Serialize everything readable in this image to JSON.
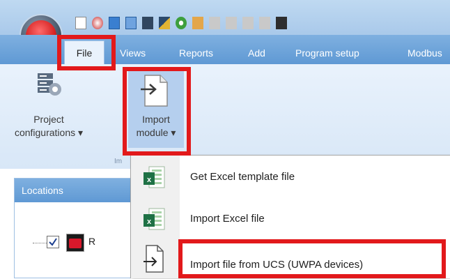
{
  "ribbon_tabs": {
    "file": "File",
    "views": "Views",
    "reports": "Reports",
    "add": "Add",
    "program_setup": "Program setup",
    "modbus": "Modbus"
  },
  "ribbon": {
    "project_configurations": "Project configurations",
    "project_configurations_line1": "Project",
    "project_configurations_line2": "configurations ▾",
    "import_module_line1": "Import",
    "import_module_line2": "module ▾",
    "group_label_partial": "Im"
  },
  "locations_panel": {
    "title": "Locations",
    "tree_item_partial": "R"
  },
  "import_menu": {
    "items": [
      {
        "label": "Get Excel template file",
        "icon": "excel-icon"
      },
      {
        "label": "Import Excel file",
        "icon": "excel-icon"
      },
      {
        "label": "Import file from UCS (UWPA devices)",
        "icon": "import-file-icon"
      }
    ]
  },
  "highlight_color": "#e2191b"
}
